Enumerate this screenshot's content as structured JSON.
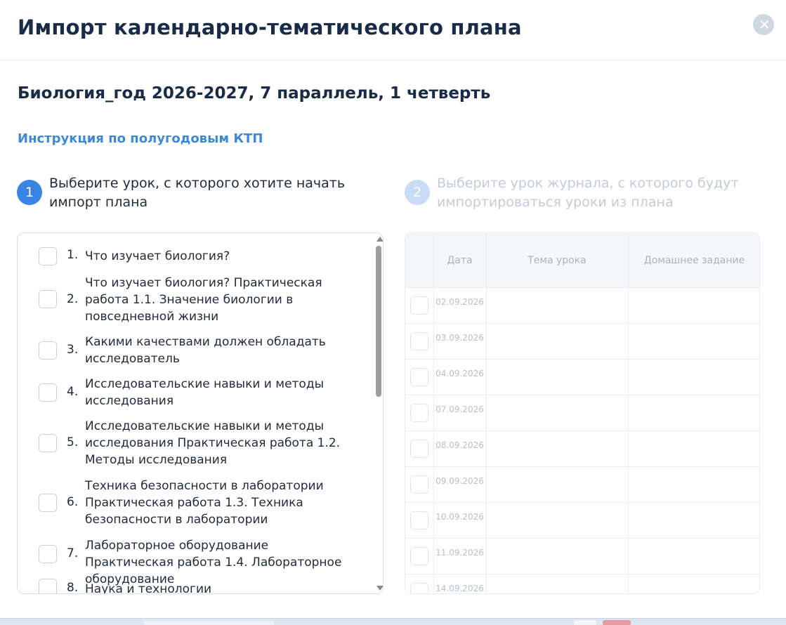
{
  "modal": {
    "title": "Импорт календарно-тематического плана",
    "close_icon": "close-icon",
    "subtitle": "Биология_год 2026-2027, 7 параллель, 1 четверть",
    "instruction_link": "Инструкция по полугодовым КТП"
  },
  "steps": [
    {
      "number": "1",
      "text": "Выберите урок, с которого хотите начать импорт плана",
      "active": true
    },
    {
      "number": "2",
      "text": "Выберите урок журнала, с которого будут импортироваться уроки из плана",
      "active": false
    }
  ],
  "lessons": [
    {
      "num": "1.",
      "title": "Что изучает биология?"
    },
    {
      "num": "2.",
      "title": "Что изучает биология? Практическая работа 1.1. Значение биологии в повседневной жизни"
    },
    {
      "num": "3.",
      "title": "Какими качествами должен обладать исследователь"
    },
    {
      "num": "4.",
      "title": "Исследовательские навыки и методы исследования"
    },
    {
      "num": "5.",
      "title": "Исследовательские навыки и методы исследования Практическая работа 1.2. Методы исследования"
    },
    {
      "num": "6.",
      "title": "Техника безопасности в лаборатории Практическая работа 1.3. Техника безопасности в лаборатории"
    },
    {
      "num": "7.",
      "title": "Лабораторное оборудование Практическая работа 1.4. Лабораторное оборудование"
    },
    {
      "num": "8.",
      "title": "Наука и технологии"
    }
  ],
  "journal_table": {
    "headers": {
      "date": "Дата",
      "topic": "Тема урока",
      "homework": "Домашнее задание"
    },
    "rows": [
      {
        "date": "02.09.2026"
      },
      {
        "date": "03.09.2026"
      },
      {
        "date": "04.09.2026"
      },
      {
        "date": "07.09.2026"
      },
      {
        "date": "08.09.2026"
      },
      {
        "date": "09.09.2026"
      },
      {
        "date": "10.09.2026"
      },
      {
        "date": "11.09.2026"
      },
      {
        "date": "14.09.2026"
      }
    ]
  },
  "colors": {
    "accent": "#3a85e4",
    "link": "#3c89d9",
    "title": "#1a2b48",
    "disabled": "#c3ccd8"
  }
}
